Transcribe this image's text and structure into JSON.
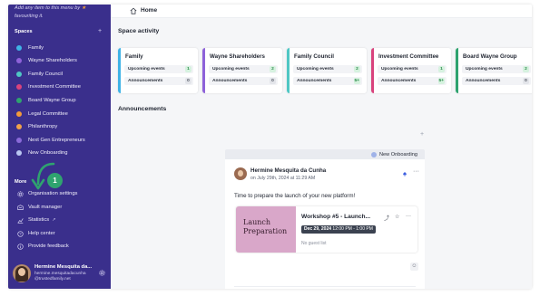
{
  "sidebar": {
    "hint_text": "Add any item to this menu by",
    "hint_text2": "favouriting it.",
    "spaces_title": "Spaces",
    "spaces_add": "+",
    "spaces": [
      {
        "label": "Family",
        "color": "#3fb3e6"
      },
      {
        "label": "Wayne Shareholders",
        "color": "#8e62d9"
      },
      {
        "label": "Family Council",
        "color": "#4fc7c4"
      },
      {
        "label": "Investment Committee",
        "color": "#d9437d"
      },
      {
        "label": "Board Wayne Group",
        "color": "#2fa36f"
      },
      {
        "label": "Legal Committee",
        "color": "#f29a3a"
      },
      {
        "label": "Philanthropy",
        "color": "#f0a14a"
      },
      {
        "label": "Next Gen Entrepreneurs",
        "color": "#8a6ad9"
      },
      {
        "label": "New Onboarding",
        "color": "#b9c6f2"
      }
    ],
    "more_title": "More",
    "more": [
      {
        "label": "Organisation settings",
        "icon": "gear-icon"
      },
      {
        "label": "Vault manager",
        "icon": "vault-icon"
      },
      {
        "label": "Statistics",
        "icon": "chart-icon"
      },
      {
        "label": "Help center",
        "icon": "help-icon"
      },
      {
        "label": "Provide feedback",
        "icon": "info-icon"
      }
    ],
    "annotation_number": "1",
    "user": {
      "name": "Hermine Mesquita da...",
      "email": "hermine.mesquitadacunha @trustedfamily.net"
    }
  },
  "topbar": {
    "title": "Home"
  },
  "space_activity": {
    "title": "Space activity",
    "row_labels": {
      "events": "Upcoming events",
      "announcements": "Announcements"
    },
    "cards": [
      {
        "name": "Family",
        "color": "#3fb3e6",
        "events": "1",
        "announcements": "0"
      },
      {
        "name": "Wayne Shareholders",
        "color": "#8e62d9",
        "events": "2",
        "announcements": "0"
      },
      {
        "name": "Family Council",
        "color": "#4fc7c4",
        "events": "2",
        "announcements": "5+"
      },
      {
        "name": "Investment Committee",
        "color": "#d9437d",
        "events": "1",
        "announcements": "5+"
      },
      {
        "name": "Board Wayne Group",
        "color": "#2fa36f",
        "events": "2",
        "announcements": "0"
      }
    ]
  },
  "announcements": {
    "title": "Announcements",
    "plus": "+",
    "space_chip": "New Onboarding",
    "post": {
      "author": "Hermine Mesquita da Cunha",
      "time": "on July 29th, 2024 at 11:29 AM",
      "text": "Time to prepare the launch of your new platform!",
      "event": {
        "image_text": "Launch Preparation",
        "title": "Workshop #5 - Launch...",
        "date": "Dec 29, 2024",
        "time": " 12:00 PM - 1:00 PM",
        "guests": "No guest list"
      }
    }
  }
}
